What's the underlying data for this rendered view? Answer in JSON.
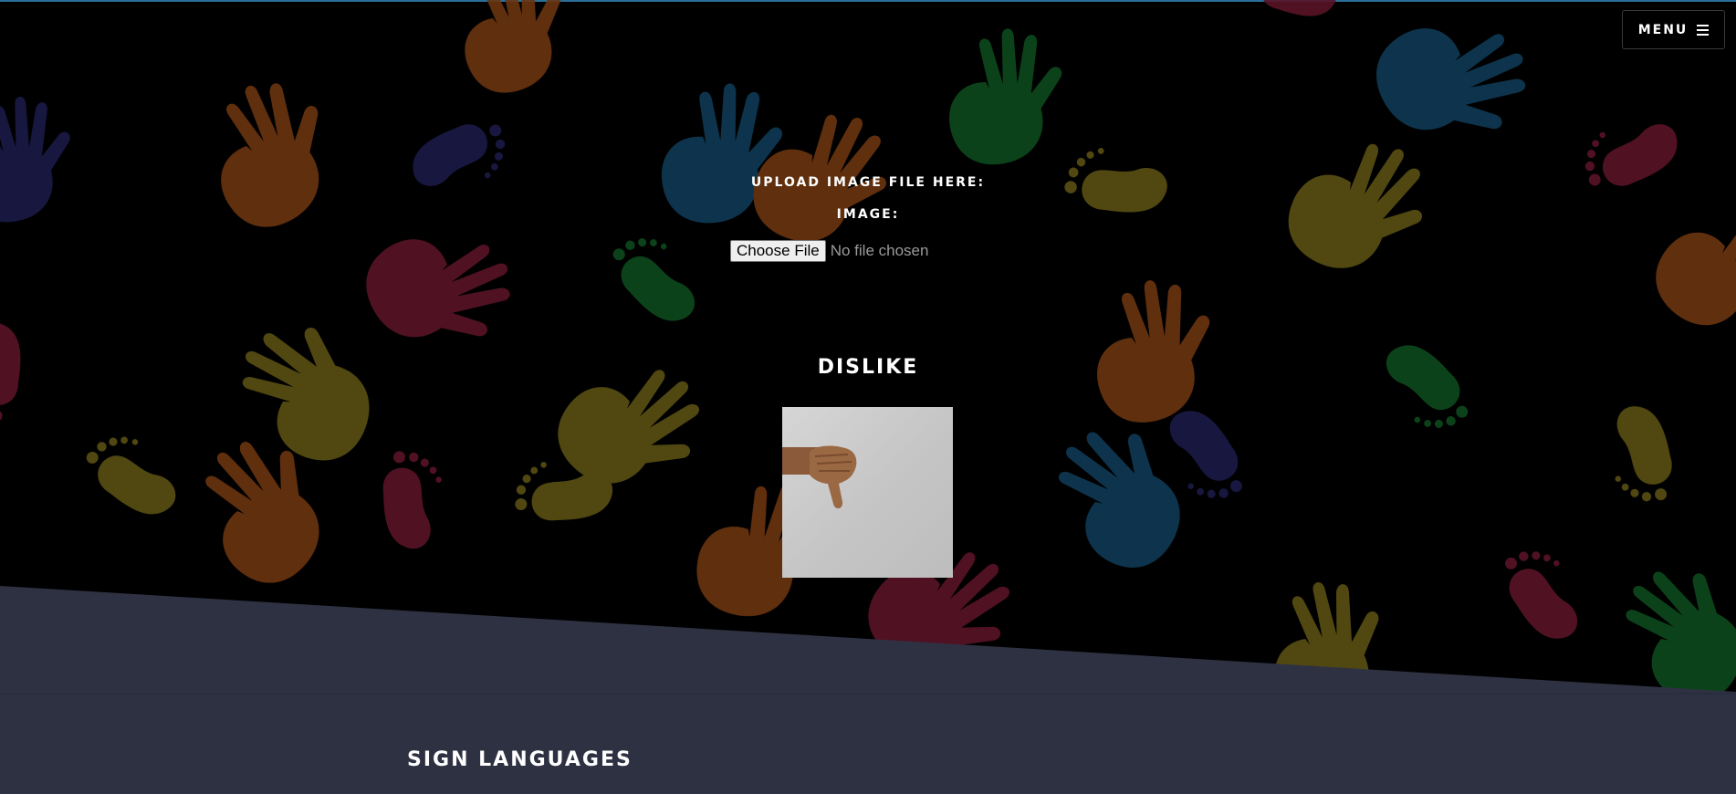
{
  "header": {
    "menu_label": "MENU",
    "menu_icon": "hamburger-icon"
  },
  "upload": {
    "heading": "UPLOAD IMAGE FILE HERE:",
    "image_label": "IMAGE:",
    "choose_file_label": "Choose File",
    "no_file_text": "No file chosen"
  },
  "result": {
    "prediction": "DISLIKE",
    "image_subject": "thumbs-down-hand-gesture"
  },
  "section": {
    "title": "SIGN LANGUAGES"
  },
  "colors": {
    "background": "#000000",
    "band": "#2e3142",
    "top_line": "#2a6f97",
    "hand_palette": [
      "#6b3510",
      "#0f3a55",
      "#0e4a1e",
      "#5a5014",
      "#5a1428",
      "#1a1a48"
    ]
  }
}
